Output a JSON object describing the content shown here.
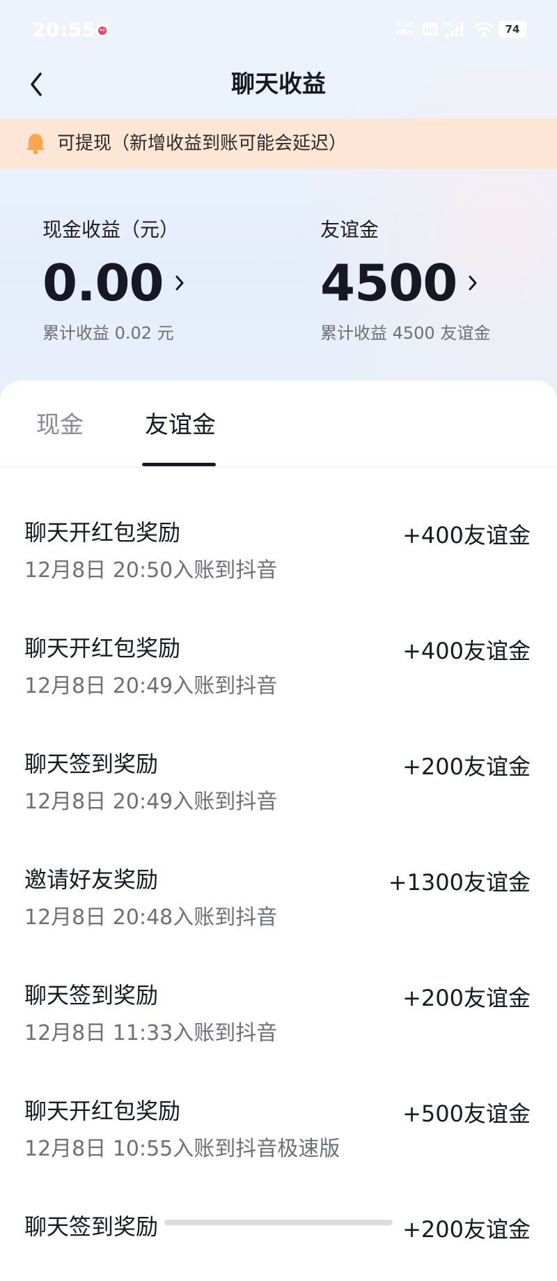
{
  "status_bar": {
    "time": "20:55",
    "net_speed": "0.20",
    "net_unit": "KB/s",
    "battery": "74",
    "icons": [
      "douyin-app-icon",
      "hd-icon",
      "5g-signal-icon",
      "wifi-icon",
      "battery-icon"
    ]
  },
  "nav": {
    "title": "聊天收益",
    "back_icon": "chevron-left-icon"
  },
  "notice": {
    "text": "可提现（新增收益到账可能会延迟）",
    "icon": "bell-icon",
    "color": "#fde6d6"
  },
  "cash": {
    "label": "现金收益（元）",
    "value": "0.00",
    "total": "累计收益 0.02 元"
  },
  "friend_gold": {
    "label": "友谊金",
    "value": "4500",
    "total": "累计收益 4500 友谊金"
  },
  "tabs": [
    {
      "label": "现金",
      "active": false
    },
    {
      "label": "友谊金",
      "active": true
    }
  ],
  "records": [
    {
      "title": "聊天开红包奖励",
      "date": "12月8日 20:50入账到抖音",
      "amount": "+400友谊金"
    },
    {
      "title": "聊天开红包奖励",
      "date": "12月8日 20:49入账到抖音",
      "amount": "+400友谊金"
    },
    {
      "title": "聊天签到奖励",
      "date": "12月8日 20:49入账到抖音",
      "amount": "+200友谊金"
    },
    {
      "title": "邀请好友奖励",
      "date": "12月8日 20:48入账到抖音",
      "amount": "+1300友谊金"
    },
    {
      "title": "聊天签到奖励",
      "date": "12月8日 11:33入账到抖音",
      "amount": "+200友谊金"
    },
    {
      "title": "聊天开红包奖励",
      "date": "12月8日 10:55入账到抖音极速版",
      "amount": "+500友谊金"
    },
    {
      "title": "聊天签到奖励",
      "date": "",
      "amount": "+200友谊金"
    }
  ]
}
